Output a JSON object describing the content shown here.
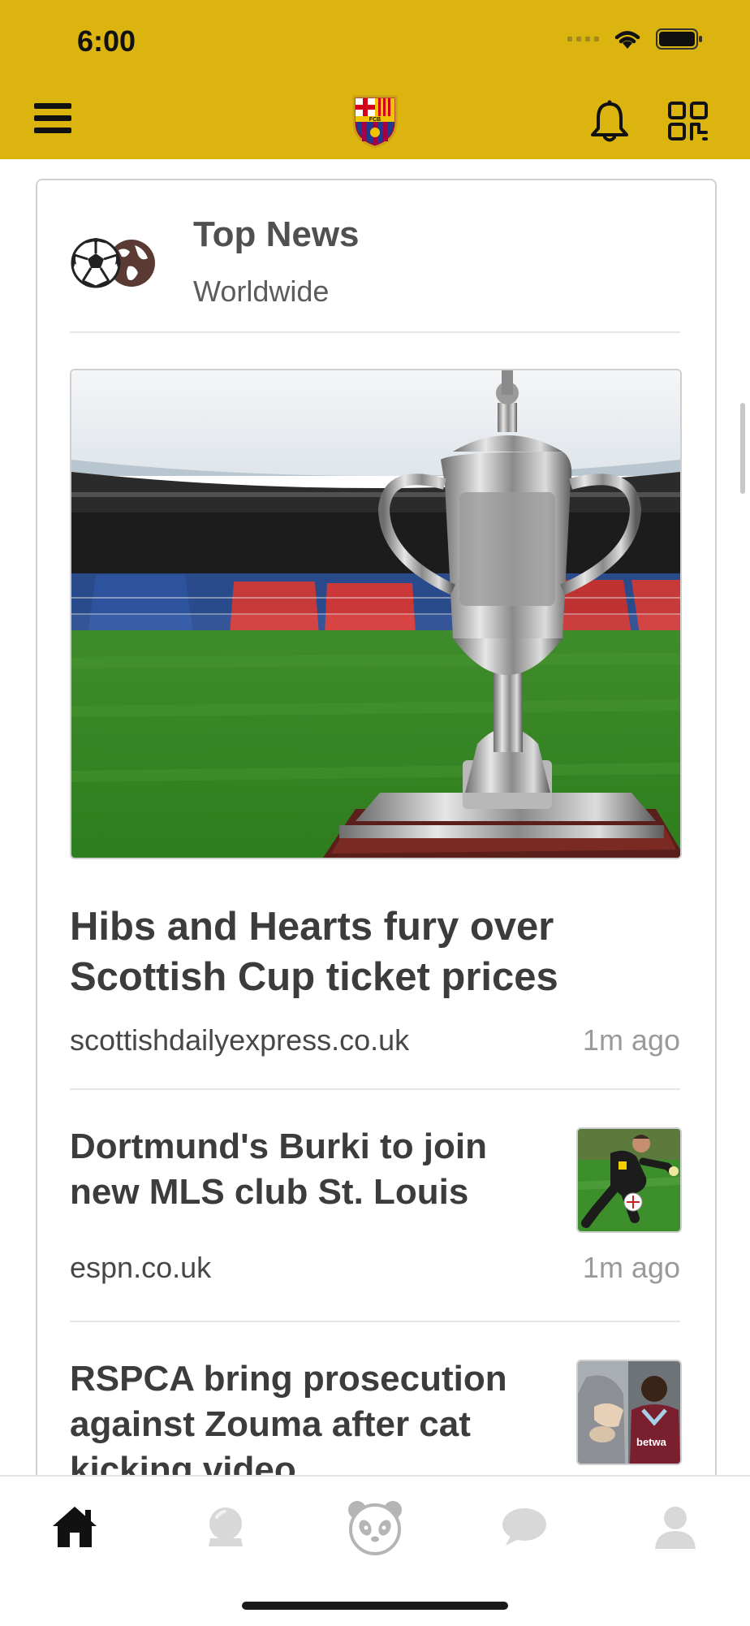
{
  "status_bar": {
    "time": "6:00"
  },
  "header": {
    "menu_icon": "hamburger-menu-icon",
    "logo": "fc-barcelona-crest",
    "logo_text": "FCB",
    "notification_icon": "bell-icon",
    "scan_icon": "qr-code-icon",
    "background_color": "#dcb40f"
  },
  "card": {
    "title": "Top News",
    "subtitle": "Worldwide",
    "icon": "soccer-globe-icon"
  },
  "articles": [
    {
      "title_line1": "Hibs and Hearts fury over",
      "title_line2": "Scottish Cup ticket prices",
      "source": "scottishdailyexpress.co.uk",
      "time": "1m ago",
      "image": "scottish-cup-trophy-photo"
    },
    {
      "title_line1": "Dortmund's Burki to join",
      "title_line2": "new MLS club St. Louis",
      "source": "espn.co.uk",
      "time": "1m ago",
      "image": "goalkeeper-photo"
    },
    {
      "title_line1": "RSPCA bring prosecution",
      "title_line2": "against Zouma after cat",
      "title_line3": "kicking video",
      "source": "",
      "time": "",
      "image": "zouma-photo",
      "thumb_text": "betwa"
    }
  ],
  "bottom_nav": {
    "items": [
      {
        "icon": "home-icon",
        "active": true
      },
      {
        "icon": "crystal-ball-icon",
        "active": false
      },
      {
        "icon": "panda-icon",
        "active": false
      },
      {
        "icon": "chat-bubble-icon",
        "active": false
      },
      {
        "icon": "profile-icon",
        "active": false
      }
    ]
  }
}
